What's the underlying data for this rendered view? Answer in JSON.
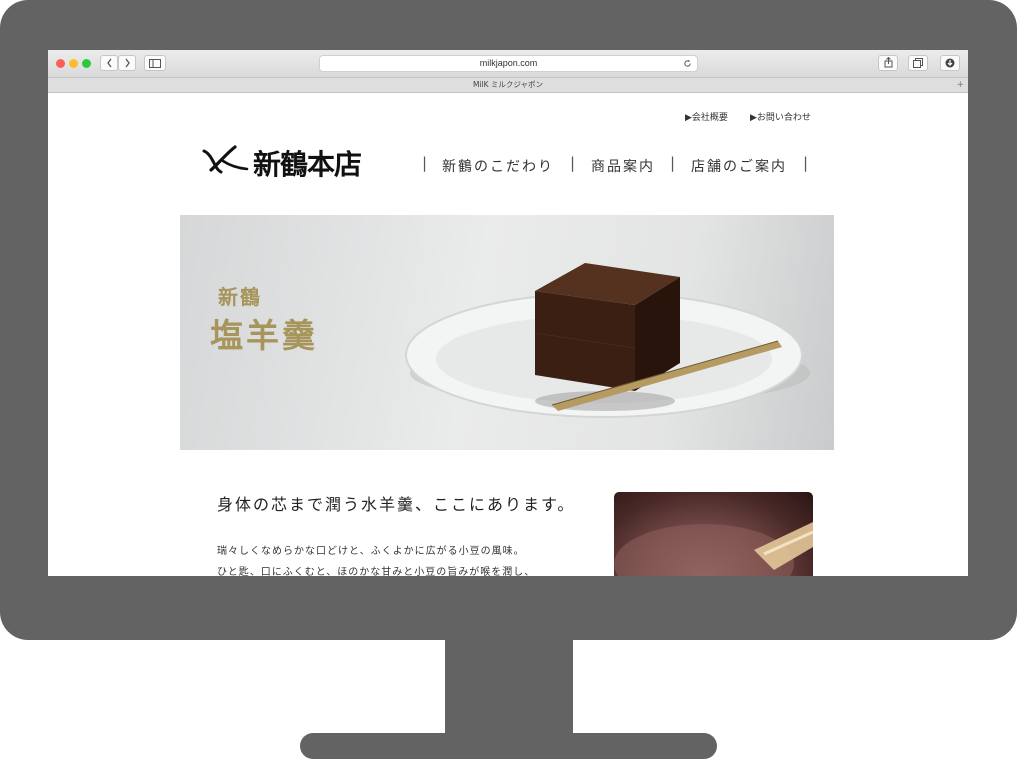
{
  "browser": {
    "url": "milkjapon.com",
    "tab_title": "MilK ミルクジャポン",
    "icons": [
      "back-icon",
      "forward-icon",
      "sidebar-icon",
      "reload-icon",
      "share-icon",
      "tabs-icon",
      "download-icon",
      "new-tab-icon"
    ]
  },
  "header": {
    "util_links": [
      "▶会社概要",
      "▶お問い合わせ"
    ],
    "logo_text": "新鶴本店",
    "nav": [
      "新鶴のこだわり",
      "商品案内",
      "店舗のご案内"
    ]
  },
  "hero": {
    "label_small": "新鶴",
    "label_large": "塩羊羹"
  },
  "content": {
    "headline": "身体の芯まで潤う水羊羹、ここにあります。",
    "paragraph_lines": [
      "瑞々しくなめらかな口どけと、ふくよかに広がる小豆の風味。",
      "ひと匙、口にふくむと、ほのかな甘みと小豆の旨みが喉を潤し、"
    ]
  },
  "colors": {
    "monitor": "#636363",
    "hero_gold": "#a8955c",
    "yokan": "#3a1f12"
  }
}
